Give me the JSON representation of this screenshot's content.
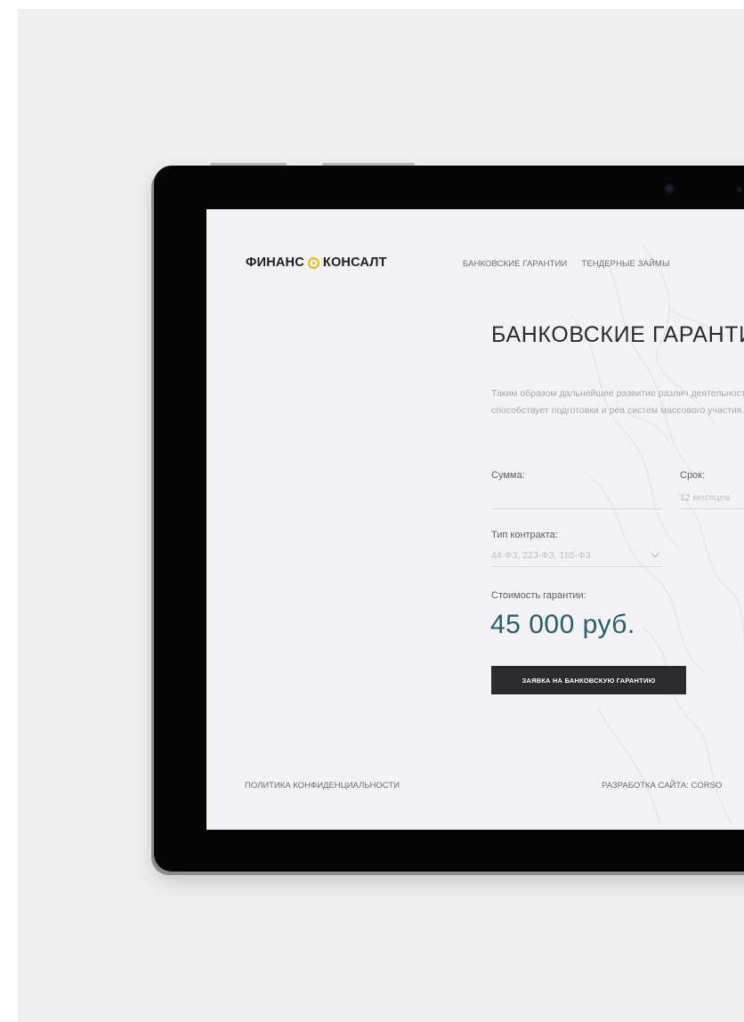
{
  "brand": {
    "part1": "ФИНАНС",
    "part2": "КОНСАЛТ",
    "accent_color": "#f2b705"
  },
  "nav": {
    "items": [
      "БАНКОВСКИЕ ГАРАНТИИ",
      "ТЕНДЕРНЫЕ ЗАЙМЫ"
    ]
  },
  "main": {
    "title": "БАНКОВСКИЕ ГАРАНТИ",
    "description": "Таким образом дальнейшее развитие различ деятельности способствует подготовки и реа систем массового участия.",
    "fields": {
      "sum": {
        "label": "Сумма:",
        "value": ""
      },
      "term": {
        "label": "Срок:",
        "value": "12 месяцев"
      },
      "contract": {
        "label": "Тип контракта:",
        "value": "44-ФЗ, 223-ФЗ, 185-ФЗ"
      }
    },
    "cost_label": "Стоимость гарантии:",
    "cost_value": "45 000 руб.",
    "cost_color": "#2a5d6b",
    "cta_label": "ЗАЯВКА НА БАНКОВСКУЮ ГАРАНТИЮ"
  },
  "footer": {
    "privacy": "ПОЛИТИКА КОНФИДЕНЦИАЛЬНОСТИ",
    "dev": "РАЗРАБОТКА САЙТА: CORSO"
  }
}
